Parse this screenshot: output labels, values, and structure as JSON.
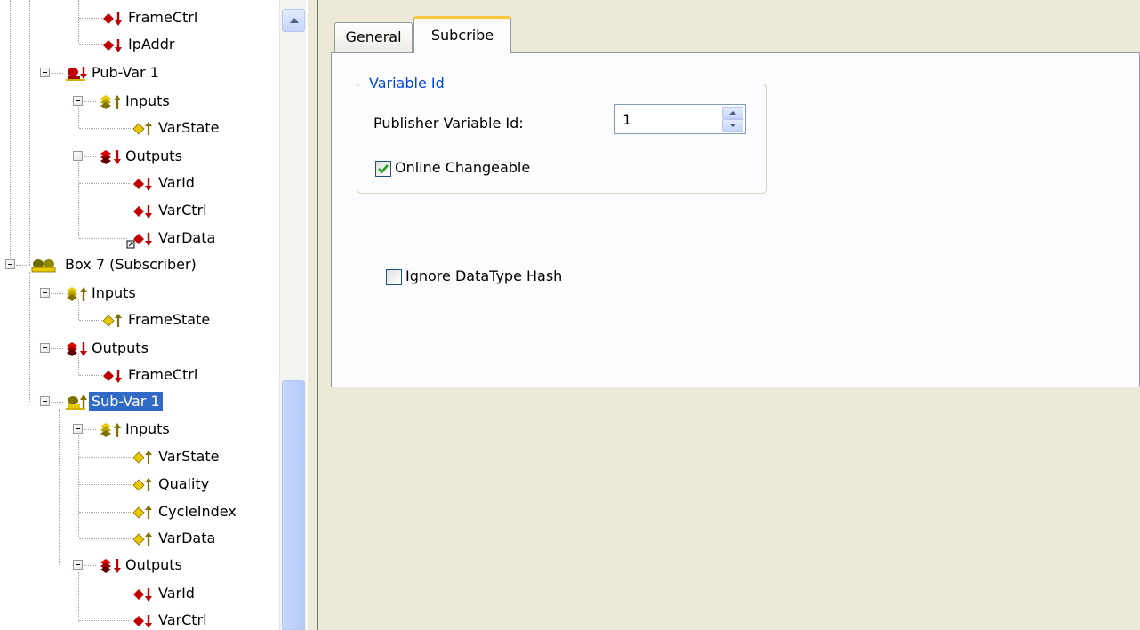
{
  "tree": {
    "nodes": [
      {
        "label": "FrameCtrl",
        "icon": "output-var-icon"
      },
      {
        "label": "IpAddr",
        "icon": "output-var-icon"
      },
      {
        "label": "Pub-Var 1",
        "icon": "publisher-var-icon"
      },
      {
        "label": "Inputs",
        "icon": "inputs-folder-icon"
      },
      {
        "label": "VarState",
        "icon": "input-var-icon"
      },
      {
        "label": "Outputs",
        "icon": "outputs-folder-icon"
      },
      {
        "label": "VarId",
        "icon": "output-var-icon"
      },
      {
        "label": "VarCtrl",
        "icon": "output-var-icon"
      },
      {
        "label": "VarData",
        "icon": "output-var-linked-icon"
      },
      {
        "label": "Box 7 (Subscriber)",
        "icon": "box-subscriber-icon"
      },
      {
        "label": "Inputs",
        "icon": "inputs-folder-icon"
      },
      {
        "label": "FrameState",
        "icon": "input-var-icon"
      },
      {
        "label": "Outputs",
        "icon": "outputs-folder-icon"
      },
      {
        "label": "FrameCtrl",
        "icon": "output-var-icon"
      },
      {
        "label": "Sub-Var 1",
        "icon": "subscriber-var-icon",
        "selected": true
      },
      {
        "label": "Inputs",
        "icon": "inputs-folder-icon"
      },
      {
        "label": "VarState",
        "icon": "input-var-icon"
      },
      {
        "label": "Quality",
        "icon": "input-var-icon"
      },
      {
        "label": "CycleIndex",
        "icon": "input-var-icon"
      },
      {
        "label": "VarData",
        "icon": "input-var-icon"
      },
      {
        "label": "Outputs",
        "icon": "outputs-folder-icon"
      },
      {
        "label": "VarId",
        "icon": "output-var-icon"
      },
      {
        "label": "VarCtrl",
        "icon": "output-var-icon"
      }
    ]
  },
  "tabs": {
    "general": "General",
    "subscribe": "Subcribe",
    "active": "subscribe"
  },
  "variable_group": {
    "title": "Variable Id",
    "publisher_label": "Publisher Variable Id:",
    "publisher_value": "1",
    "online_changeable_label": "Online Changeable",
    "online_changeable_checked": true
  },
  "ignore_hash": {
    "label": "Ignore DataType Hash",
    "checked": false
  },
  "colors": {
    "selection": "#316ac5",
    "group_title": "#0046d5",
    "check_mark": "#21a121",
    "tab_highlight": "#ffc83c"
  }
}
